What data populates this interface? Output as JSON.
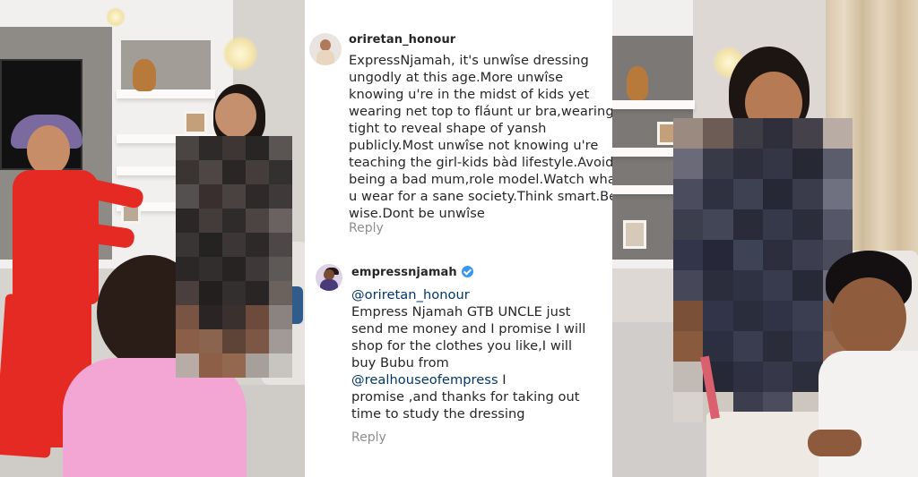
{
  "comments": [
    {
      "username": "oriretan_honour",
      "verified": false,
      "avatar": "user-avatar-icon",
      "text_lines": [
        "ExpressNjamah, it's unwîse dressing",
        "ungodly at this age.More unwîse",
        "knowing u're in the midst of kids yet",
        "wearing net top to fláunt ur bra,wearing",
        "tight to reveal shape of yansh",
        "publicly.Most unwîse not knowing u're",
        "teaching the girl-kids bàd lifestyle.Avoid",
        "being a bad mum,role model.Watch what",
        "u wear for a sane society.Think smart.Bé",
        "wise.Dont be unwîse"
      ],
      "reply_label": "Reply"
    },
    {
      "username": "empressnjamah",
      "verified": true,
      "avatar": "user-avatar-icon",
      "mention": "@oriretan_honour",
      "text_lines": [
        "Empress Njamah GTB UNCLE just",
        "send me money and I promise I will",
        "shop for the clothes you like,I will",
        "buy Bubu from"
      ],
      "mention2": "@realhouseofempress",
      "text_lines2": [
        " I",
        "promise ,and thanks for taking out",
        "time to study the dressing"
      ],
      "reply_label": "Reply"
    }
  ],
  "colors": {
    "username": "#262626",
    "text": "#262626",
    "mention": "#00376b",
    "reply": "#8e8e8e",
    "verified_badge": "#3897f0"
  }
}
